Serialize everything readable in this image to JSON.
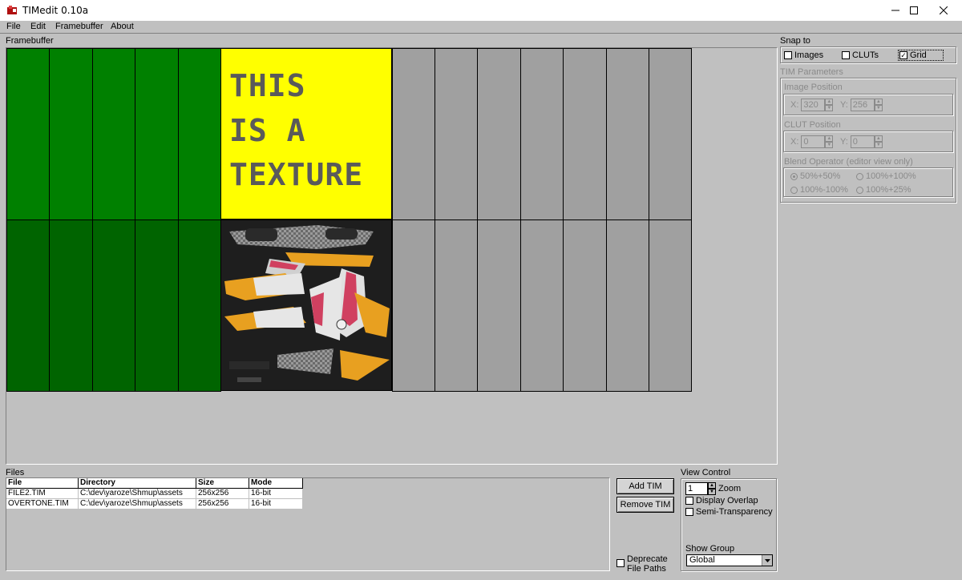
{
  "window": {
    "title": "TIMedit 0.10a",
    "minimize": "minimize",
    "maximize": "maximize",
    "close": "close"
  },
  "menu": {
    "file": "File",
    "edit": "Edit",
    "framebuffer": "Framebuffer",
    "about": "About"
  },
  "framebuffer": {
    "label": "Framebuffer",
    "texture_lines": [
      "THIS",
      "IS A",
      "TEXTURE"
    ]
  },
  "snap_to": {
    "label": "Snap to",
    "images": "Images",
    "cluts": "CLUTs",
    "grid": "Grid",
    "grid_checked": true
  },
  "tim_params": {
    "label": "TIM Parameters",
    "image_position": {
      "label": "Image Position",
      "x_label": "X:",
      "x": "320",
      "y_label": "Y:",
      "y": "256"
    },
    "clut_position": {
      "label": "CLUT Position",
      "x_label": "X:",
      "x": "0",
      "y_label": "Y:",
      "y": "0"
    },
    "blend": {
      "label": "Blend Operator (editor view only)",
      "opt1": "50%+50%",
      "opt2": "100%+100%",
      "opt3": "100%-100%",
      "opt4": "100%+25%"
    }
  },
  "files": {
    "label": "Files",
    "columns": [
      "File",
      "Directory",
      "Size",
      "Mode"
    ],
    "rows": [
      [
        "FILE2.TIM",
        "C:\\dev\\yaroze\\Shmup\\assets",
        "256x256",
        "16-bit"
      ],
      [
        "OVERTONE.TIM",
        "C:\\dev\\yaroze\\Shmup\\assets",
        "256x256",
        "16-bit"
      ]
    ]
  },
  "buttons": {
    "add": "Add TIM",
    "remove": "Remove TIM"
  },
  "deprecate": {
    "line1": "Deprecate",
    "line2": "File Paths"
  },
  "view_control": {
    "label": "View Control",
    "zoom_value": "1",
    "zoom_label": "Zoom",
    "display_overlap": "Display Overlap",
    "semi_transparency": "Semi-Transparency",
    "show_group_label": "Show Group",
    "show_group_value": "Global"
  }
}
